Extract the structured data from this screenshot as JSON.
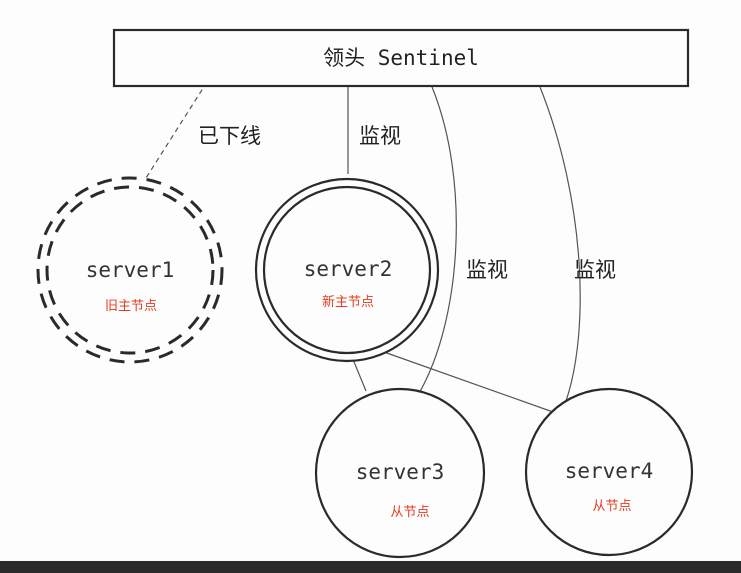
{
  "leader": {
    "title": "领头 Sentinel"
  },
  "edges": {
    "offline_label": "已下线",
    "monitor_label_1": "监视",
    "monitor_label_2": "监视",
    "monitor_label_3": "监视"
  },
  "servers": [
    {
      "id": "server1",
      "name": "server1",
      "role": "旧主节点",
      "status": "offline"
    },
    {
      "id": "server2",
      "name": "server2",
      "role": "新主节点",
      "status": "master"
    },
    {
      "id": "server3",
      "name": "server3",
      "role": "从节点",
      "status": "slave"
    },
    {
      "id": "server4",
      "name": "server4",
      "role": "从节点",
      "status": "slave"
    }
  ],
  "colors": {
    "background": "#fdfdfd",
    "stroke": "#2a2a2a",
    "line": "#555555",
    "role_text": "#e23b1f",
    "frame": "#1c1c1c"
  }
}
